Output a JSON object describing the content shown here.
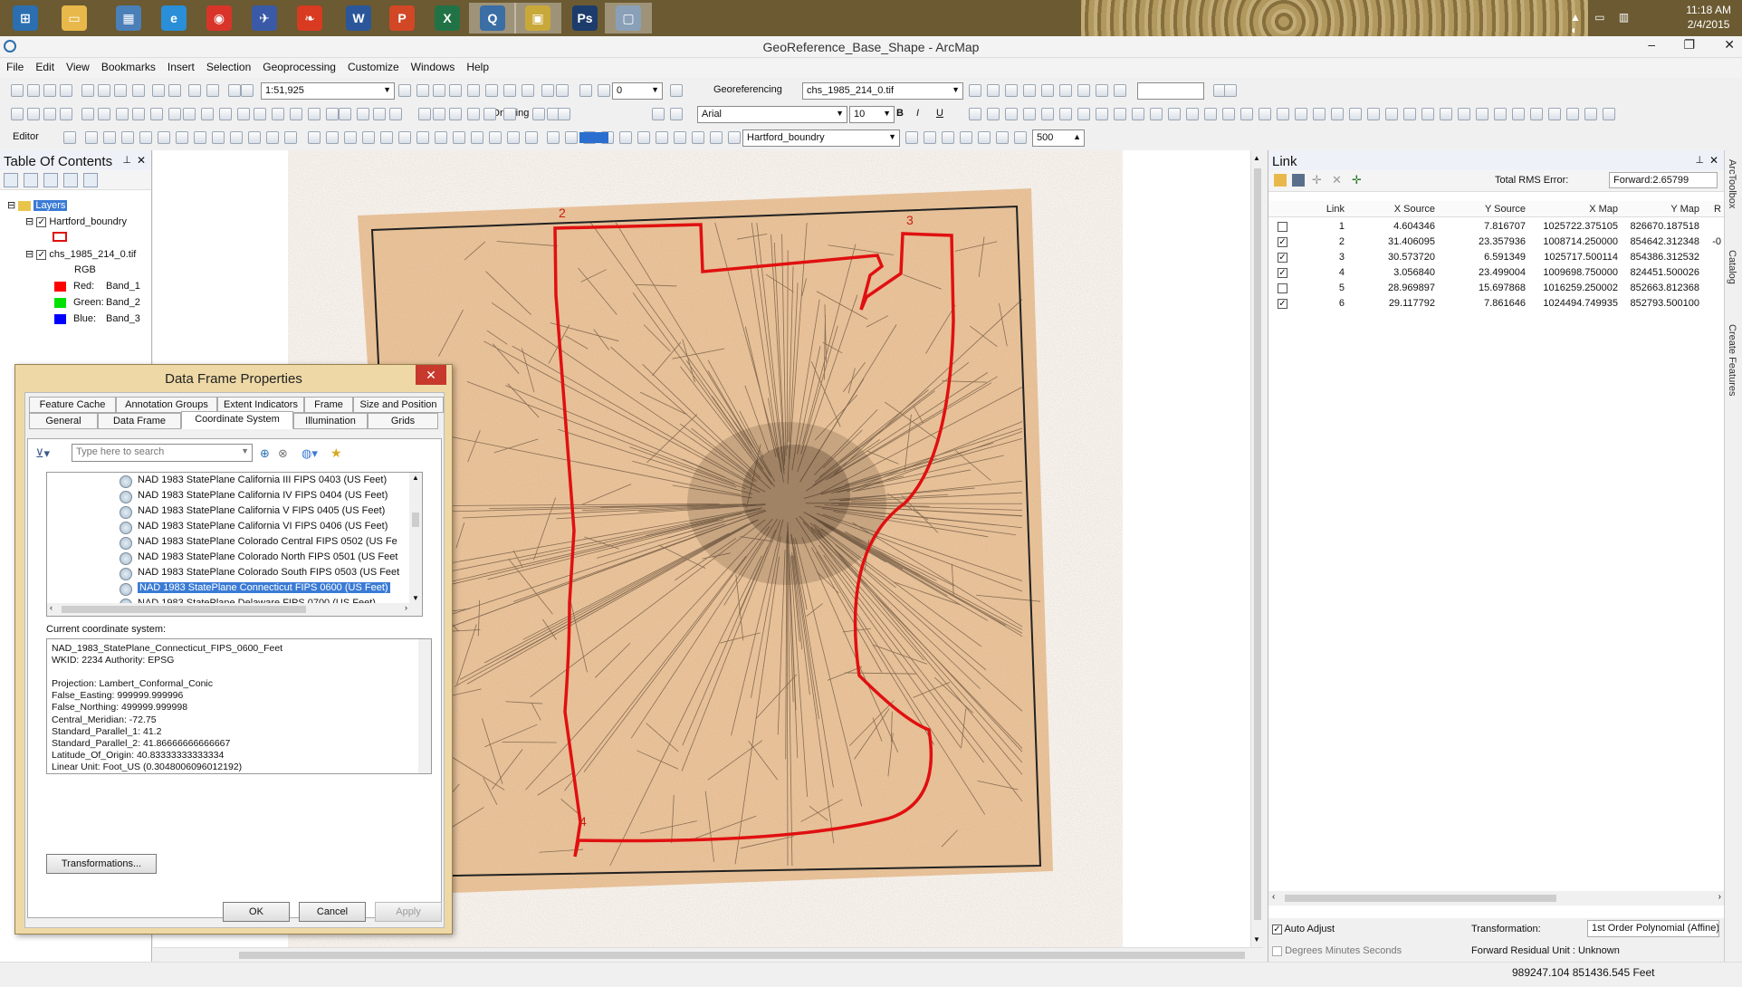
{
  "taskbar": {
    "apps": [
      {
        "name": "windows-start-icon",
        "active": false,
        "color": "#2b6fb0",
        "glyph": "⊞"
      },
      {
        "name": "file-explorer-icon",
        "active": false,
        "color": "#e8b84a",
        "glyph": "▭"
      },
      {
        "name": "control-panel-icon",
        "active": false,
        "color": "#4a7fb8",
        "glyph": "▦"
      },
      {
        "name": "internet-explorer-icon",
        "active": false,
        "color": "#2a8fd8",
        "glyph": "e"
      },
      {
        "name": "chrome-icon",
        "active": false,
        "color": "#d8342a",
        "glyph": "◉"
      },
      {
        "name": "thunderbird-icon",
        "active": false,
        "color": "#3a5aa8",
        "glyph": "✈"
      },
      {
        "name": "red-pepper-icon",
        "active": false,
        "color": "#d83a22",
        "glyph": "❧"
      },
      {
        "name": "word-icon",
        "active": false,
        "color": "#2b579a",
        "glyph": "W"
      },
      {
        "name": "powerpoint-icon",
        "active": false,
        "color": "#d24726",
        "glyph": "P"
      },
      {
        "name": "excel-icon",
        "active": false,
        "color": "#217346",
        "glyph": "X"
      },
      {
        "name": "arcmap-icon",
        "active": true,
        "color": "#3a6ea5",
        "glyph": "Q"
      },
      {
        "name": "arccatalog-icon",
        "active": true,
        "color": "#c9a83a",
        "glyph": "▣"
      },
      {
        "name": "photoshop-icon",
        "active": false,
        "color": "#1c3c6c",
        "glyph": "Ps"
      },
      {
        "name": "image-viewer-icon",
        "active": true,
        "color": "#8aa0b8",
        "glyph": "▢"
      }
    ],
    "clock": {
      "time": "11:18 AM",
      "date": "2/4/2015"
    }
  },
  "window": {
    "title": "GeoReference_Base_Shape - ArcMap"
  },
  "menu": [
    "File",
    "Edit",
    "View",
    "Bookmarks",
    "Insert",
    "Selection",
    "Geoprocessing",
    "Customize",
    "Windows",
    "Help"
  ],
  "toolbar": {
    "scale": "1:51,925",
    "georef_label": "Georeferencing",
    "georef_layer": "chs_1985_214_0.tif",
    "drawing_label": "Drawing",
    "font_name": "Arial",
    "font_size": "10",
    "editor_label": "Editor",
    "layer_combo": "Hartford_boundry",
    "zoom_value": "500",
    "spin_value": "0",
    "bold": "B",
    "italic": "I",
    "underline": "U"
  },
  "toc": {
    "title": "Table Of Contents",
    "layers_label": "Layers",
    "layer1": "Hartford_boundry",
    "layer2": "chs_1985_214_0.tif",
    "rgb": "RGB",
    "bands": [
      {
        "label": "Red:",
        "band": "Band_1",
        "color": "#ff0000"
      },
      {
        "label": "Green:",
        "band": "Band_2",
        "color": "#00e000"
      },
      {
        "label": "Blue:",
        "band": "Band_3",
        "color": "#0000ff"
      }
    ]
  },
  "map": {
    "link_labels": [
      "2",
      "3",
      "4"
    ],
    "boundary_color": "#e01010"
  },
  "link_panel": {
    "title": "Link",
    "rms_label": "Total RMS Error:",
    "rms_value": "Forward:2.65799",
    "columns": [
      "Link",
      "X Source",
      "Y Source",
      "X Map",
      "Y Map",
      "R"
    ],
    "rows": [
      {
        "checked": false,
        "link": "1",
        "xs": "4.604346",
        "ys": "7.816707",
        "xm": "1025722.375105",
        "ym": "826670.187518",
        "r": ""
      },
      {
        "checked": true,
        "link": "2",
        "xs": "31.406095",
        "ys": "23.357936",
        "xm": "1008714.250000",
        "ym": "854642.312348",
        "r": "-0"
      },
      {
        "checked": true,
        "link": "3",
        "xs": "30.573720",
        "ys": "6.591349",
        "xm": "1025717.500114",
        "ym": "854386.312532",
        "r": ""
      },
      {
        "checked": true,
        "link": "4",
        "xs": "3.056840",
        "ys": "23.499004",
        "xm": "1009698.750000",
        "ym": "824451.500026",
        "r": ""
      },
      {
        "checked": false,
        "link": "5",
        "xs": "28.969897",
        "ys": "15.697868",
        "xm": "1016259.250002",
        "ym": "852663.812368",
        "r": ""
      },
      {
        "checked": true,
        "link": "6",
        "xs": "29.117792",
        "ys": "7.861646",
        "xm": "1024494.749935",
        "ym": "852793.500100",
        "r": ""
      }
    ],
    "auto_adjust": "Auto Adjust",
    "degrees_label": "Degrees Minutes Seconds",
    "transformation_label": "Transformation:",
    "transformation_value": "1st Order Polynomial (Affine)",
    "residual_label": "Forward Residual Unit : Unknown"
  },
  "dock": {
    "items": [
      "ArcToolbox",
      "Catalog",
      "Create Features"
    ]
  },
  "status": {
    "coords": "989247.104  851436.545 Feet"
  },
  "dialog": {
    "title": "Data Frame Properties",
    "tabs_row1": [
      "Feature Cache",
      "Annotation Groups",
      "Extent Indicators",
      "Frame",
      "Size and Position"
    ],
    "tabs_row2": [
      "General",
      "Data Frame",
      "Coordinate System",
      "Illumination",
      "Grids"
    ],
    "search_placeholder": "Type here to search",
    "crs_list": [
      "NAD 1983 StatePlane California III FIPS 0403 (US Feet)",
      "NAD 1983 StatePlane California IV FIPS 0404 (US Feet)",
      "NAD 1983 StatePlane California V FIPS 0405 (US Feet)",
      "NAD 1983 StatePlane California VI FIPS 0406 (US Feet)",
      "NAD 1983 StatePlane Colorado Central FIPS 0502 (US Fe",
      "NAD 1983 StatePlane Colorado North FIPS 0501 (US Feet",
      "NAD 1983 StatePlane Colorado South FIPS 0503 (US Feet",
      "NAD 1983 StatePlane Connecticut FIPS 0600 (US Feet)",
      "NAD 1983 StatePlane Delaware FIPS 0700 (US Feet)"
    ],
    "selected_index": 7,
    "current_label": "Current coordinate system:",
    "current_lines": [
      "NAD_1983_StatePlane_Connecticut_FIPS_0600_Feet",
      "WKID: 2234 Authority: EPSG",
      "",
      "Projection: Lambert_Conformal_Conic",
      "False_Easting: 999999.999996",
      "False_Northing: 499999.999998",
      "Central_Meridian: -72.75",
      "Standard_Parallel_1: 41.2",
      "Standard_Parallel_2: 41.86666666666667",
      "Latitude_Of_Origin: 40.83333333333334",
      "Linear Unit: Foot_US (0.3048006096012192)"
    ],
    "transformations_btn": "Transformations...",
    "ok": "OK",
    "cancel": "Cancel",
    "apply": "Apply"
  }
}
